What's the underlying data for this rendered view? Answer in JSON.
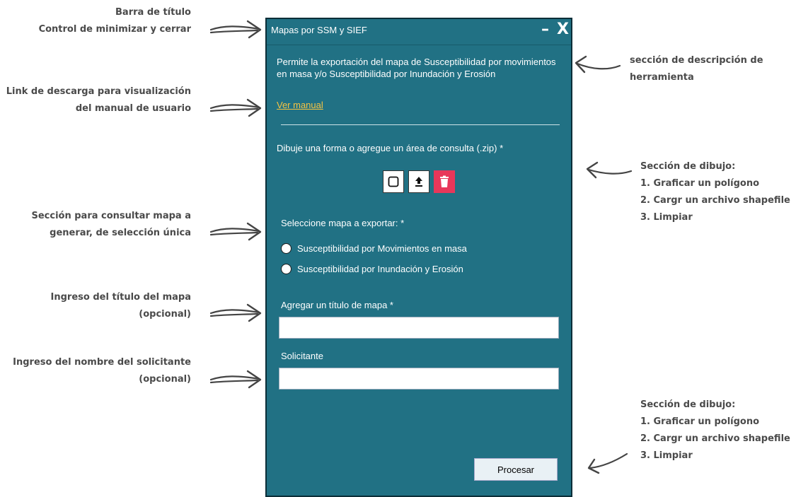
{
  "annotations": {
    "titlebar": [
      "Barra de título",
      "Control de minimizar y cerrar"
    ],
    "manual": [
      "Link de descarga para visualización",
      "del manual de usuario"
    ],
    "map_select": [
      "Sección para consultar mapa a",
      "generar, de selección única"
    ],
    "title_input": [
      "Ingreso del título del mapa",
      "(opcional)"
    ],
    "requester_input": [
      "Ingreso del nombre del solicitante",
      "(opcional)"
    ],
    "description": [
      "sección de descripción de",
      "herramienta"
    ],
    "drawing_top": [
      "Sección de dibujo:",
      "1. Graficar un polígono",
      "2. Cargr un archivo shapefile",
      "3. Limpiar"
    ],
    "drawing_bottom": [
      "Sección de dibujo:",
      "1. Graficar un polígono",
      "2. Cargr un archivo shapefile",
      "3. Limpiar"
    ]
  },
  "panel": {
    "title": "Mapas por SSM y SIEF",
    "minimize_label": "–",
    "close_label": "X",
    "description": "Permite la exportación del mapa de Susceptibilidad por movimientos en masa y/o Susceptibilidad por Inundación y Erosión",
    "manual_link": "Ver manual",
    "draw_prompt": "Dibuje una forma o agregue un área de consulta (.zip) *",
    "tools": [
      {
        "name": "draw-polygon",
        "icon": "square-outline-icon"
      },
      {
        "name": "upload-shapefile",
        "icon": "upload-icon"
      },
      {
        "name": "clear",
        "icon": "trash-icon"
      }
    ],
    "map_select_label": "Seleccione mapa a exportar: *",
    "map_options": [
      "Susceptibilidad por Movimientos en masa",
      "Susceptibilidad por Inundación y Erosión"
    ],
    "title_label": "Agregar un título de mapa *",
    "title_value": "",
    "requester_label": "Solicitante",
    "requester_value": "",
    "process_button": "Procesar"
  },
  "colors": {
    "panel_bg": "#217184",
    "link": "#f6c342",
    "delete_bg": "#e8375a",
    "annotation_text": "#4a4a4a"
  }
}
